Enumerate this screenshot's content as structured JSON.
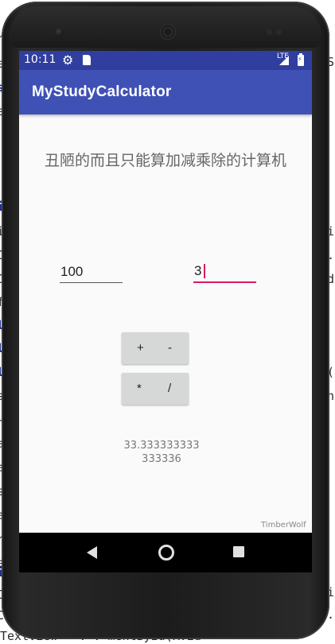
{
  "background_code": {
    "left": [
      "r",
      "e",
      "s",
      "e",
      "i",
      "i",
      "C",
      "C",
      "f",
      "l",
      "l",
      "l",
      "s",
      "-",
      "a",
      "a",
      "s",
      "a",
      "r",
      "e",
      "i",
      "C",
      "C"
    ],
    "right": [
      "St",
      "",
      "",
      "",
      "i",
      "i",
      ".",
      "d",
      "",
      "",
      "",
      "",
      "(",
      "n",
      "",
      "",
      "",
      "",
      "",
      "",
      "",
      "i",
      "."
    ],
    "bottom": "TextView   =      .    .   mentById(R.id"
  },
  "status_bar": {
    "time": "10:11",
    "network": "LTE",
    "icons": [
      "gear-icon",
      "sd-card-icon",
      "signal-icon",
      "battery-icon"
    ]
  },
  "app_bar": {
    "title": "MyStudyCalculator"
  },
  "heading": "丑陋的而且只能算加减乘除的计算机",
  "inputs": {
    "first_value": "100",
    "second_value": "3"
  },
  "operators": {
    "add": "+",
    "subtract": "-",
    "multiply": "*",
    "divide": "/"
  },
  "result": "33.333333333333336",
  "watermark": "TimberWolf",
  "colors": {
    "status_bar": "#303f9f",
    "app_bar": "#3f51b5",
    "accent": "#d81b60",
    "screen_bg": "#fafafa",
    "button_bg": "#d6d7d7"
  },
  "nav_bar": {
    "icons": [
      "back-icon",
      "home-icon",
      "recent-apps-icon"
    ]
  }
}
